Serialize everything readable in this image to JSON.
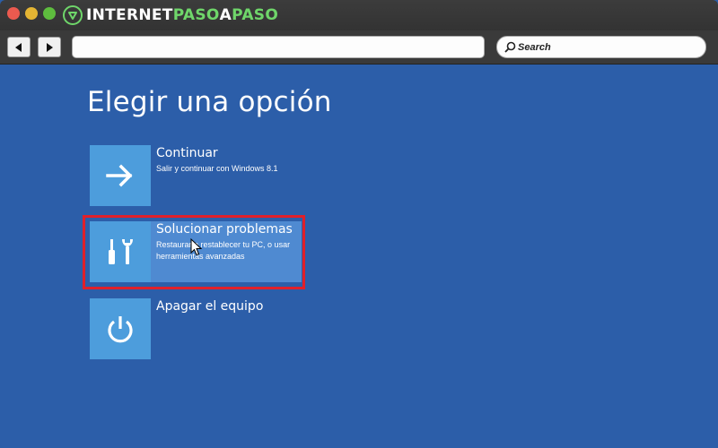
{
  "window": {
    "logo": {
      "part1": "INTERNET",
      "part2": "PASO",
      "part3": "A",
      "part4": "PASO"
    }
  },
  "toolbar": {
    "back_icon": "back-arrow-icon",
    "forward_icon": "forward-arrow-icon",
    "url_value": "",
    "search_placeholder": "Search"
  },
  "main": {
    "title": "Elegir una opción",
    "options": [
      {
        "title": "Continuar",
        "description": "Salir y continuar con Windows 8.1",
        "icon": "arrow-right-icon"
      },
      {
        "title": "Solucionar problemas",
        "description": "Restaurar o restablecer tu PC, o usar herramientas avanzadas",
        "icon": "tools-icon"
      },
      {
        "title": "Apagar el equipo",
        "description": "",
        "icon": "power-icon"
      }
    ]
  },
  "colors": {
    "background": "#2c5ea9",
    "tile": "#4d9ddc",
    "highlight_border": "#e0202a",
    "selected_row": "#4f8ad1",
    "logo_accent": "#6fd66a"
  }
}
